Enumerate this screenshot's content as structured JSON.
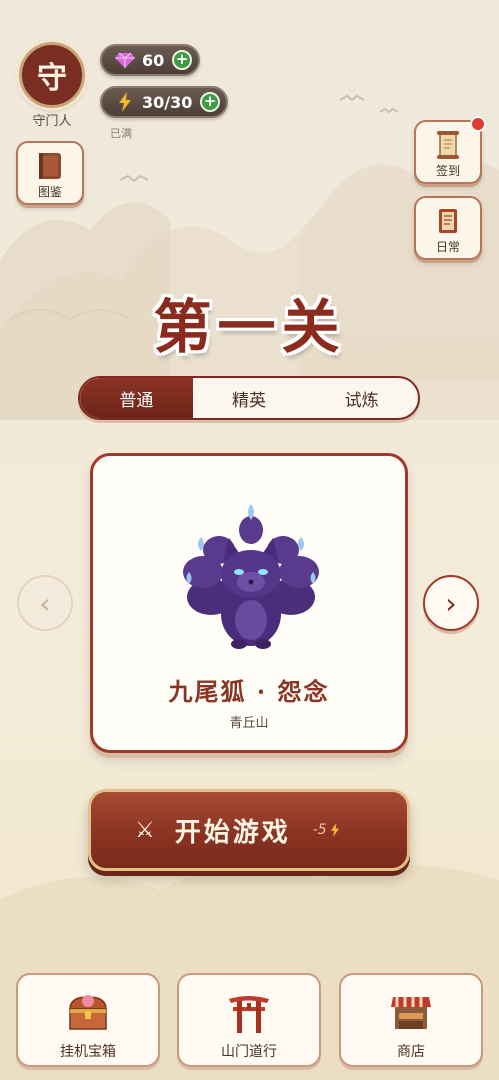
{
  "player": {
    "avatar_char": "守",
    "name": "守门人"
  },
  "resources": {
    "gems": "60",
    "energy": "30/30",
    "energy_status": "已满"
  },
  "side_buttons": {
    "codex": "图鉴",
    "checkin": "签到",
    "daily": "日常"
  },
  "level": {
    "title": "第一关"
  },
  "tabs": [
    {
      "label": "普通",
      "active": true
    },
    {
      "label": "精英",
      "active": false
    },
    {
      "label": "试炼",
      "active": false
    }
  ],
  "boss": {
    "name": "九尾狐 · 怨念",
    "location": "青丘山",
    "icon": "nine-tailed-fox"
  },
  "nav_arrows": {
    "prev": "‹",
    "next": "›"
  },
  "start": {
    "label": "开始游戏",
    "cost": "-5"
  },
  "bottom_nav": [
    {
      "label": "挂机宝箱",
      "icon": "treasure-chest-icon"
    },
    {
      "label": "山门道行",
      "icon": "torii-gate-icon"
    },
    {
      "label": "商店",
      "icon": "shop-stall-icon"
    }
  ],
  "colors": {
    "primary": "#8a2b1e",
    "accent_gold": "#e3c08a",
    "background": "#f2ead8",
    "notification": "#e0392f",
    "plus_green": "#3f9a43"
  }
}
